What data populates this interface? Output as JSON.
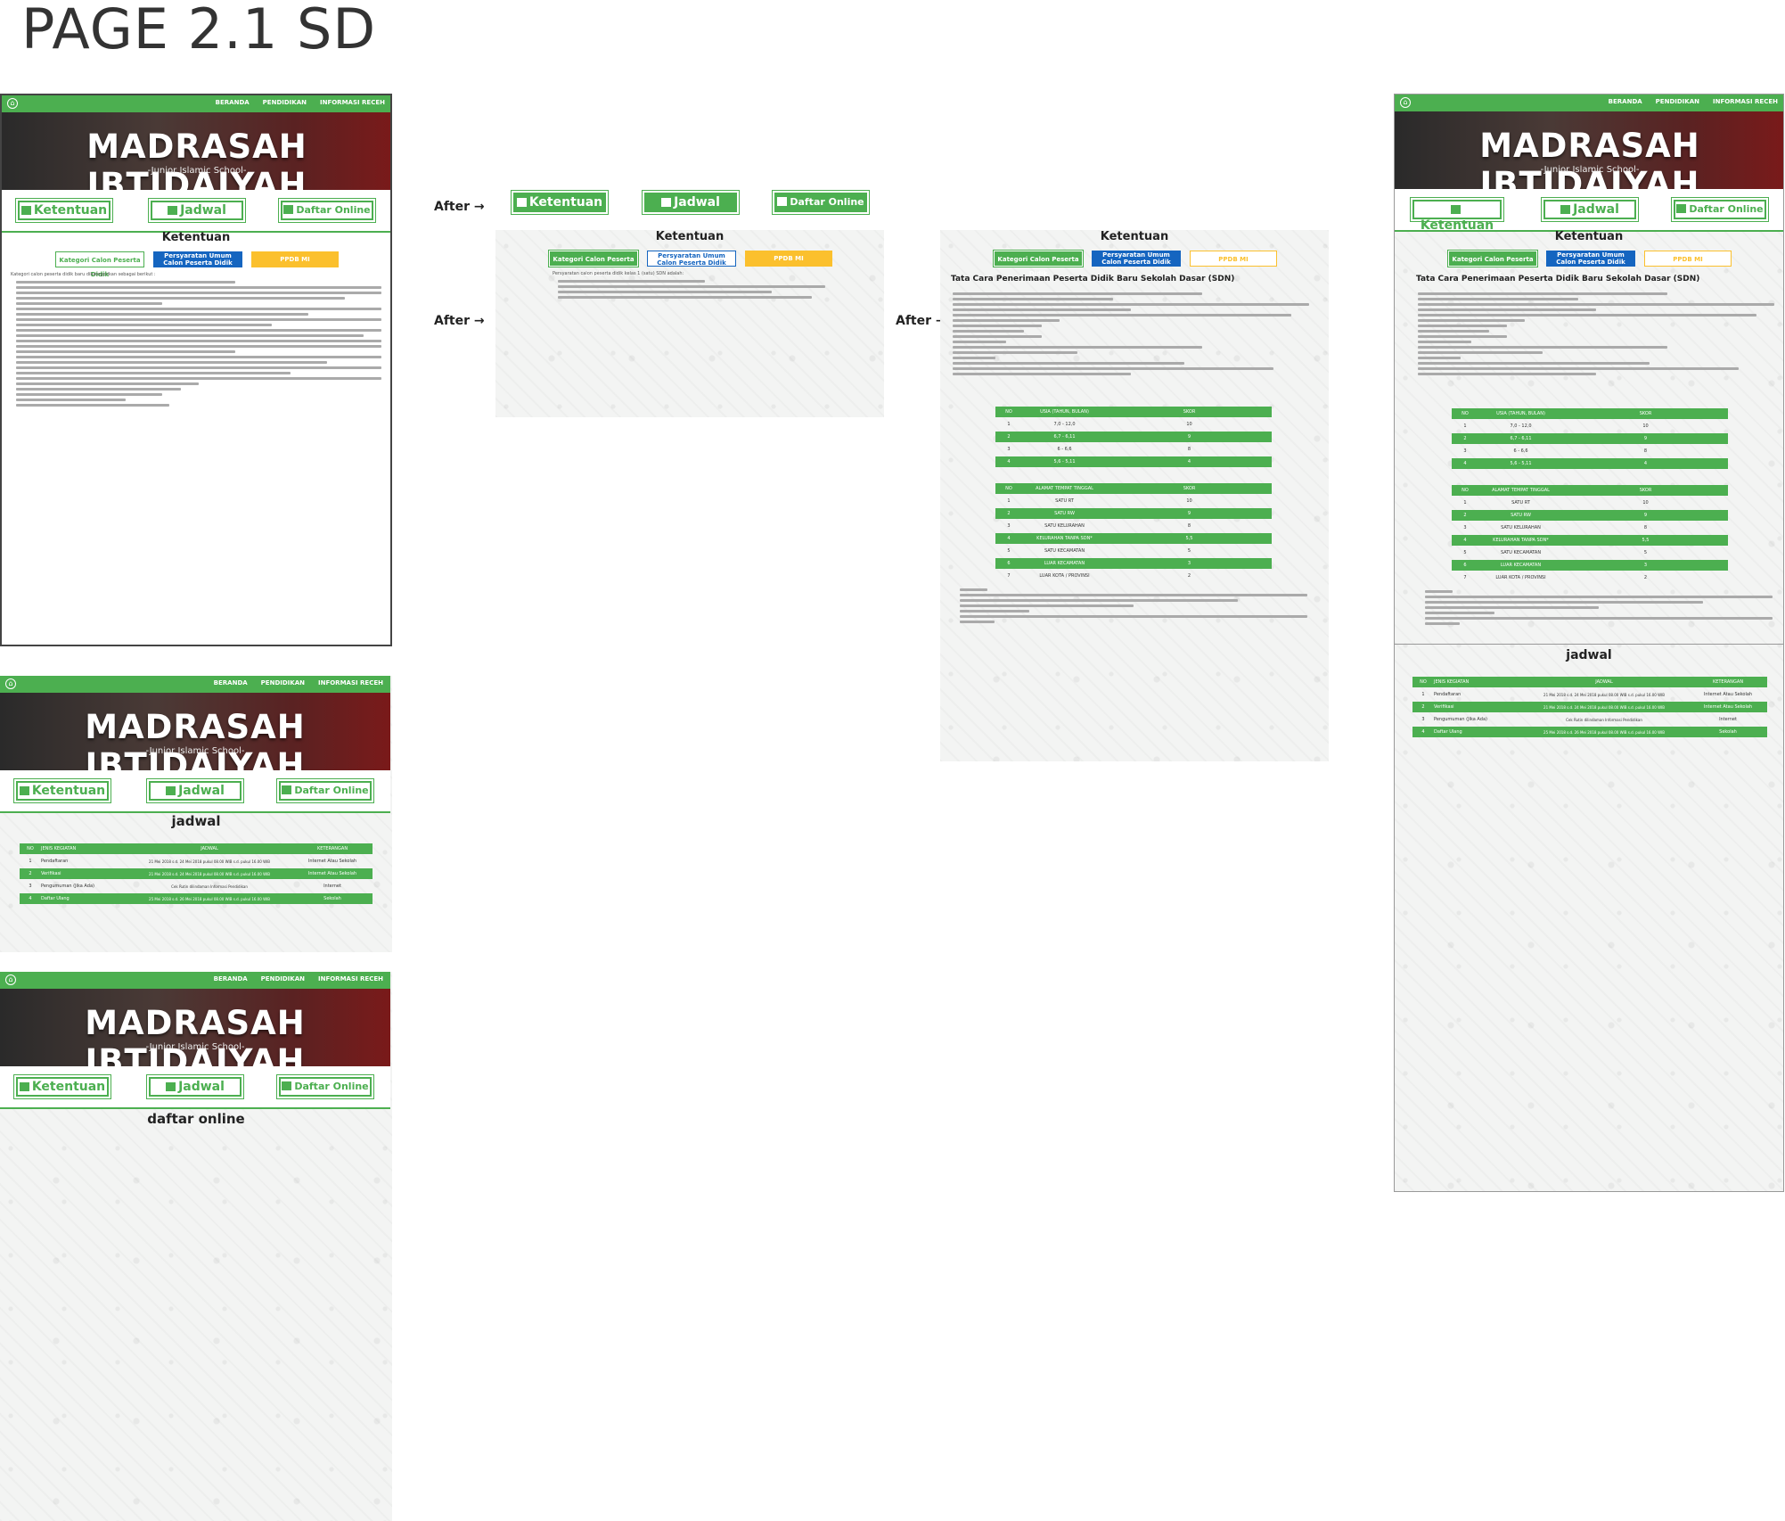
{
  "page_title": "PAGE 2.1 SD",
  "header": {
    "nav": [
      "BERANDA",
      "PENDIDIKAN",
      "INFORMASI RECEH"
    ],
    "title": "MADRASAH IBTIDAIYAH",
    "subtitle": "-Junior Islamic School-"
  },
  "tabs": {
    "ketentuan": "Ketentuan",
    "jadwal": "Jadwal",
    "daftar": "Daftar Online"
  },
  "after_label": "After →",
  "ketentuan": {
    "heading": "Ketentuan",
    "tab_kategori": "Kategori Calon Peserta Didik",
    "tab_persyaratan": "Persyaratan Umum Calon Peserta Didik",
    "tab_ppdb": "PPDB MI",
    "intro": "Kategori calon peserta didik baru dikategorikan sebagai berikut :",
    "intro2": "Persyaratan calon peserta didik kelas 1 (satu) SDN adalah:",
    "tata_cara": "Tata Cara Penerimaan Peserta Didik Baru Sekolah Dasar (SDN)"
  },
  "usia_table": {
    "headers": [
      "NO",
      "USIA (TAHUN, BULAN)",
      "SKOR"
    ],
    "rows": [
      [
        "1",
        "7,0 - 12,0",
        "10"
      ],
      [
        "2",
        "6,7 - 6,11",
        "9"
      ],
      [
        "3",
        "6 - 6,6",
        "8"
      ],
      [
        "4",
        "5,6 - 5,11",
        "4"
      ]
    ]
  },
  "alamat_table": {
    "headers": [
      "NO",
      "ALAMAT TEMPAT TINGGAL",
      "SKOR"
    ],
    "rows": [
      [
        "1",
        "SATU RT",
        "10"
      ],
      [
        "2",
        "SATU RW",
        "9"
      ],
      [
        "3",
        "SATU KELURAHAN",
        "8"
      ],
      [
        "4",
        "KELURAHAN TANPA SDN*",
        "5,5"
      ],
      [
        "5",
        "SATU KECAMATAN",
        "5"
      ],
      [
        "6",
        "LUAR KECAMATAN",
        "3"
      ],
      [
        "7",
        "LUAR KOTA / PROVINSI",
        "2"
      ]
    ]
  },
  "jadwal": {
    "heading": "jadwal",
    "headers": [
      "NO",
      "JENIS KEGIATAN",
      "JADWAL",
      "KETERANGAN"
    ],
    "rows": [
      [
        "1",
        "Pendaftaran",
        "21 Mei 2018 s.d. 24 Mei 2018 pukul 08.00 WIB s.d. pukul 16.00 WIB",
        "Internet Atau Sekolah"
      ],
      [
        "2",
        "Verifikasi",
        "21 Mei 2018 s.d. 24 Mei 2018 pukul 08.00 WIB s.d. pukul 16.00 WIB",
        "Internet Atau Sekolah"
      ],
      [
        "3",
        "Pengumuman (Jika Ada)",
        "Cek Rutin dilindaman Informasi Pendidikan",
        "Internet"
      ],
      [
        "4",
        "Daftar Ulang",
        "25 Mei 2018 s.d. 26 Mei 2018 pukul 08.00 WIB s.d. pukul 16.00 WIB",
        "Sekolah"
      ]
    ]
  },
  "daftar_online": {
    "heading": "daftar online"
  },
  "colors": {
    "green": "#4caf50",
    "blue": "#1565c0",
    "yellow": "#fbc02d"
  }
}
